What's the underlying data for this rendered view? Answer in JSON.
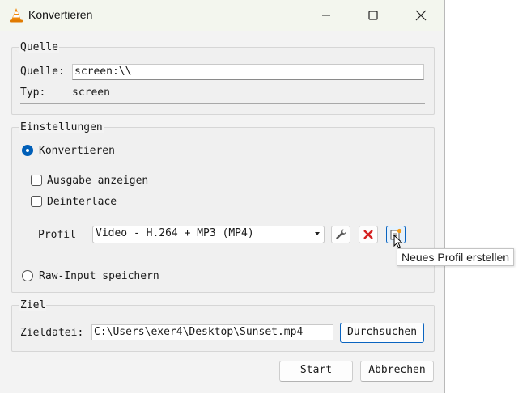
{
  "window": {
    "title": "Konvertieren",
    "minimize_icon": "minimize-icon",
    "maximize_icon": "maximize-icon",
    "close_icon": "close-icon"
  },
  "source": {
    "group_label": "Quelle",
    "source_label": "Quelle:",
    "source_value": "screen:\\\\",
    "type_label": "Typ:",
    "type_value": "screen"
  },
  "settings": {
    "group_label": "Einstellungen",
    "convert_label": "Konvertieren",
    "convert_selected": true,
    "show_output_label": "Ausgabe anzeigen",
    "show_output_checked": false,
    "deinterlace_label": "Deinterlace",
    "deinterlace_checked": false,
    "profile_label": "Profil",
    "profile_value": "Video - H.264 + MP3 (MP4)",
    "raw_input_label": "Raw-Input speichern",
    "raw_input_selected": false,
    "edit_profile_icon": "wrench-icon",
    "delete_profile_icon": "delete-x-icon",
    "new_profile_icon": "new-profile-icon"
  },
  "tooltip": {
    "text": "Neues Profil erstellen"
  },
  "destination": {
    "group_label": "Ziel",
    "file_label": "Zieldatei:",
    "file_value": "C:\\Users\\exer4\\Desktop\\Sunset.mp4",
    "browse_label": "Durchsuchen"
  },
  "footer": {
    "start_label": "Start",
    "cancel_label": "Abbrechen"
  },
  "colors": {
    "accent": "#005fb8",
    "delete_red": "#d42020",
    "titlebar": "#f3f6ee"
  }
}
